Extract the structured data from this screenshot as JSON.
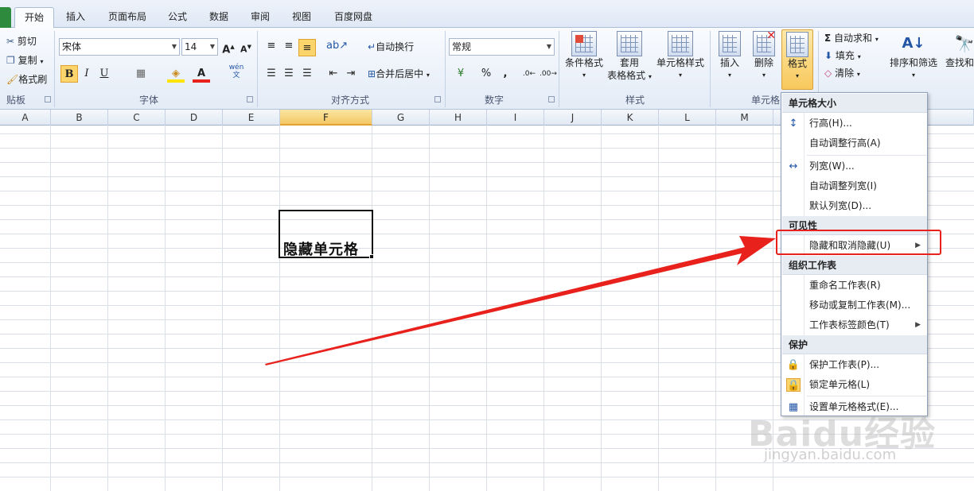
{
  "tabs": [
    "开始",
    "插入",
    "页面布局",
    "公式",
    "数据",
    "审阅",
    "视图",
    "百度网盘"
  ],
  "clipboard": {
    "cut": "剪切",
    "copy": "复制",
    "format_painter": "格式刷",
    "label": "贴板"
  },
  "font": {
    "name": "宋体",
    "size": "14",
    "label": "字体",
    "bold": "B",
    "italic": "I",
    "underline": "U",
    "phonetic": "wén"
  },
  "alignment": {
    "wrap": "自动换行",
    "merge": "合并后居中",
    "label": "对齐方式"
  },
  "number": {
    "format": "常规",
    "percent": "%",
    "comma": ",",
    "label": "数字"
  },
  "styles": {
    "conditional": "条件格式",
    "table_fmt_1": "套用",
    "table_fmt_2": "表格格式",
    "cell_styles": "单元格样式",
    "label": "样式"
  },
  "cells": {
    "insert": "插入",
    "delete": "删除",
    "format": "格式",
    "label": "单元格"
  },
  "editing": {
    "autosum": "自动求和",
    "fill": "填充",
    "clear": "清除",
    "sort": "排序和筛选",
    "find": "查找和选"
  },
  "columns": [
    "A",
    "B",
    "C",
    "D",
    "E",
    "F",
    "G",
    "H",
    "I",
    "J",
    "K",
    "L",
    "M"
  ],
  "active_column": "F",
  "cell_value": "隐藏单元格",
  "menu": {
    "sections": {
      "size": "单元格大小",
      "visibility": "可见性",
      "organize": "组织工作表",
      "protect": "保护"
    },
    "items": {
      "row_height": "行高(H)...",
      "autofit_row": "自动调整行高(A)",
      "col_width": "列宽(W)...",
      "autofit_col": "自动调整列宽(I)",
      "default_width": "默认列宽(D)...",
      "hide_unhide": "隐藏和取消隐藏(U)",
      "rename": "重命名工作表(R)",
      "move_copy": "移动或复制工作表(M)...",
      "tab_color": "工作表标签颜色(T)",
      "protect_sheet": "保护工作表(P)...",
      "lock_cell": "锁定单元格(L)",
      "format_cells": "设置单元格格式(E)..."
    }
  },
  "watermark": {
    "main": "Baidu经验",
    "sub": "jingyan.baidu.com"
  },
  "colors": {
    "accent_red": "#e8211d",
    "selected_tab_green": "#2e8b3d"
  }
}
